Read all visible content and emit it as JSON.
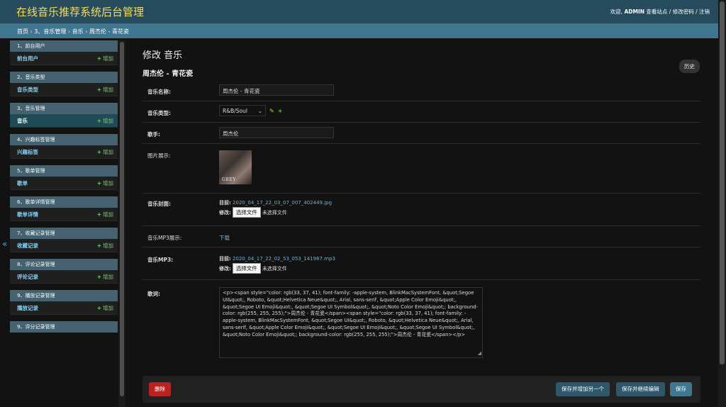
{
  "header": {
    "brand": "在线音乐推荐系统后台管理",
    "welcome": "欢迎,",
    "user": "ADMIN",
    "links": "查看站点 / 修改密码 / 注销"
  },
  "breadcrumbs": {
    "home": "首页",
    "sep1": " › ",
    "app": "3、音乐管理",
    "sep2": " › ",
    "model": "音乐",
    "sep3": " › ",
    "current": "周杰伦 - 青花瓷"
  },
  "sidebar": {
    "add_label": "增加",
    "modules": [
      {
        "caption": "1、前台用户",
        "row": "前台用户"
      },
      {
        "caption": "2、音乐类型",
        "row": "音乐类型"
      },
      {
        "caption": "3、音乐管理",
        "row": "音乐"
      },
      {
        "caption": "4、兴趣标签管理",
        "row": "兴趣标签"
      },
      {
        "caption": "5、歌单管理",
        "row": "歌单"
      },
      {
        "caption": "6、歌单详情管理",
        "row": "歌单详情"
      },
      {
        "caption": "7、收藏记录管理",
        "row": "收藏记录"
      },
      {
        "caption": "8、评论记录管理",
        "row": "评论记录"
      },
      {
        "caption": "9、播放记录管理",
        "row": "播放记录"
      },
      {
        "caption": "9、评分记录管理",
        "row": ""
      }
    ],
    "collapse_glyph": "«"
  },
  "main": {
    "page_title": "修改 音乐",
    "object_title": "周杰伦 - 青花瓷",
    "history_label": "历史",
    "fields": {
      "name_label": "音乐名称:",
      "name_value": "周杰伦 - 青花瓷",
      "type_label": "音乐类型:",
      "type_value": "R&B/Soul",
      "singer_label": "歌手:",
      "singer_value": "周杰伦",
      "image_label": "图片展示:",
      "cover_text": "GREY",
      "cover_label": "音乐封面:",
      "current_label": "目前:",
      "cover_file": "2020_04_17_22_03_07_007_402449.jpg",
      "change_label": "修改:",
      "choose_file": "选择文件",
      "no_file": "未选择文件",
      "mp3_show_label": "音乐MP3展示:",
      "download": "下载",
      "mp3_label": "音乐MP3:",
      "mp3_file": "2020_04_17_22_02_53_053_141967.mp3",
      "lyrics_label": "歌词:",
      "lyrics_value": "<p><span style=\"color: rgb(33, 37, 41); font-family: -apple-system, BlinkMacSystemFont, &quot;Segoe UI&quot;, Roboto, &quot;Helvetica Neue&quot;, Arial, sans-serif, &quot;Apple Color Emoji&quot;, &quot;Segoe UI Emoji&quot;, &quot;Segoe UI Symbol&quot;, &quot;Noto Color Emoji&quot;; background-color: rgb(255, 255, 255);\">周杰伦 - 青花瓷</span><span style=\"color: rgb(33, 37, 41); font-family: -apple-system, BlinkMacSystemFont, &quot;Segoe UI&quot;, Roboto, &quot;Helvetica Neue&quot;, Arial, sans-serif, &quot;Apple Color Emoji&quot;, &quot;Segoe UI Emoji&quot;, &quot;Segoe UI Symbol&quot;, &quot;Noto Color Emoji&quot;; background-color: rgb(255, 255, 255);\">周杰伦 - 青花瓷</span></p>"
    },
    "actions": {
      "delete": "删除",
      "save_add_another": "保存并增加另一个",
      "save_continue": "保存并继续编辑",
      "save": "保存"
    }
  },
  "colors": {
    "header_bg": "#264b5d",
    "brand": "#f5dd5d",
    "breadcrumb_bg": "#417690",
    "delete": "#ba2121",
    "save": "#417690"
  }
}
